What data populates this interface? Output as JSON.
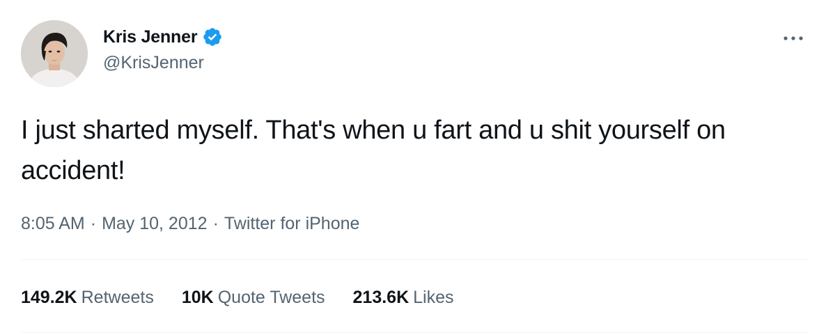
{
  "tweet": {
    "author": {
      "name": "Kris Jenner",
      "handle": "@KrisJenner",
      "verified": true,
      "avatar_icon": "profile-photo"
    },
    "more_icon": "more-horizontal-icon",
    "text": "I just sharted myself. That's when u fart and u shit yourself on accident!",
    "time": "8:05 AM",
    "separator": "·",
    "date": "May 10, 2012",
    "source": "Twitter for iPhone",
    "stats": {
      "retweets": {
        "count": "149.2K",
        "label": "Retweets"
      },
      "quote_tweets": {
        "count": "10K",
        "label": "Quote Tweets"
      },
      "likes": {
        "count": "213.6K",
        "label": "Likes"
      }
    }
  },
  "colors": {
    "text_primary": "#0f1419",
    "text_secondary": "#536471",
    "verified_blue": "#1d9bf0",
    "divider": "#eff3f4"
  }
}
